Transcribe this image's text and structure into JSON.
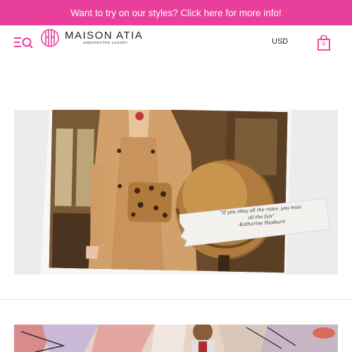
{
  "announcement": {
    "text": "Want to try on our styles? Click here for more info!"
  },
  "brand": {
    "name": "MAISON ATIA",
    "tagline": "UNEXPECTED LUXURY"
  },
  "header": {
    "currency": "USD",
    "cart_count": "0"
  },
  "hero": {
    "quote_line1": "\"If you obey all the rules, you miss",
    "quote_line2": "all the fun\"",
    "quote_author": "-Katharine Hepburn"
  },
  "colors": {
    "accent": "#e83e9c"
  },
  "icons": [
    "menu-search-icon",
    "shopping-bag-icon"
  ]
}
